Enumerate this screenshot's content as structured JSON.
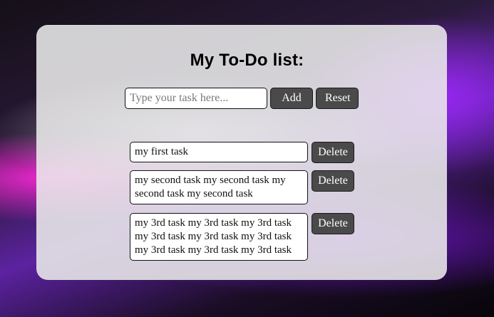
{
  "app": {
    "title": "My To-Do list:"
  },
  "input": {
    "placeholder": "Type your task here...",
    "value": ""
  },
  "buttons": {
    "add_label": "Add",
    "reset_label": "Reset",
    "delete_label": "Delete"
  },
  "tasks": [
    {
      "text": "my first task"
    },
    {
      "text": "my second task my second task my second task my second task"
    },
    {
      "text": "my 3rd task my 3rd task my 3rd task my 3rd task my 3rd task my 3rd task my 3rd task my 3rd task my 3rd task"
    }
  ],
  "colors": {
    "card_bg": "#ebebeb",
    "button_bg": "#4a4a4a",
    "button_text": "#ffffff",
    "accent_purple": "#6a1fc0",
    "accent_magenta": "#ff28dc"
  }
}
